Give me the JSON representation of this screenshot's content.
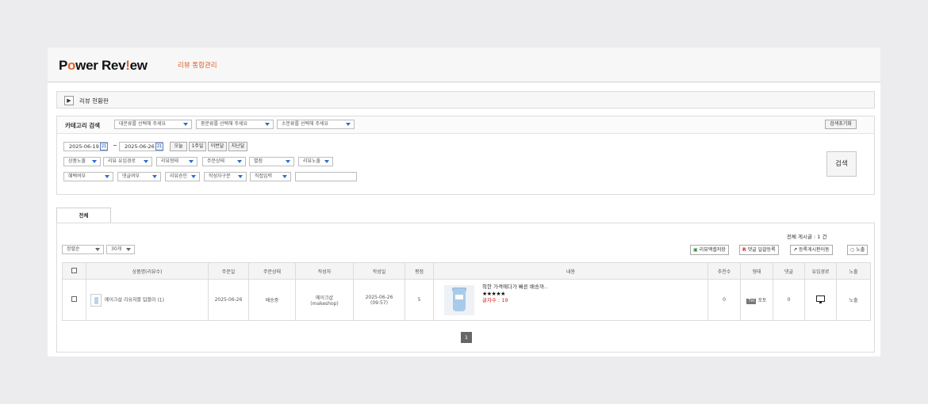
{
  "header": {
    "logo_parts": [
      "P",
      "o",
      "wer Rev",
      "!",
      "ew"
    ],
    "subtitle": "리뷰 통합관리"
  },
  "status_panel": {
    "label": "리뷰 현황판"
  },
  "category_search": {
    "title": "카테고리 검색",
    "large_placeholder": "대분류를 선택해 주세요",
    "medium_placeholder": "중분류를 선택해 주세요",
    "small_placeholder": "소분류를 선택해 주세요",
    "reset_label": "검색초기화"
  },
  "filters": {
    "date_from": "2025-06-19",
    "date_to": "2025-06-26",
    "tilde": "~",
    "calendar_glyph": "21",
    "quick_ranges": [
      "오늘",
      "1주일",
      "이번달",
      "지난달"
    ],
    "row1": [
      "상품노출",
      "리뷰 유입경로",
      "리뷰형태",
      "주문상태",
      "별점",
      "리뷰노출"
    ],
    "row2": [
      "혜택여부",
      "댓글여부",
      "리뷰승인",
      "작성자구분",
      "직접입력"
    ],
    "search_button": "검색"
  },
  "tabs": [
    {
      "label": "전체",
      "active": true
    }
  ],
  "list": {
    "sort_value": "정렬순",
    "page_size_value": "30개",
    "total_text": "전체 게시글 : 1 건",
    "actions": {
      "excel": {
        "icon": "▣",
        "label": "리뷰엑셀저장"
      },
      "bulk_reply": {
        "icon": "R",
        "label": "댓글 일괄등록"
      },
      "move_board": {
        "icon": "↗",
        "label": "등록게시판이동"
      },
      "expose": {
        "icon": "○",
        "label": "노출"
      }
    },
    "columns": [
      "상품명(리뷰수)",
      "주문일",
      "주문상태",
      "작성자",
      "작성일",
      "평점",
      "내용",
      "추천수",
      "형태",
      "댓글",
      "유입경로",
      "노출"
    ],
    "rows": [
      {
        "product": "메이크샵 리유저블 텀블러 (1)",
        "order_date": "2025-06-26",
        "order_status": "배송중",
        "writer_name": "메이크샵",
        "writer_id": "(makeshop)",
        "write_date": "2025-06-26",
        "write_time": "(09:57)",
        "rating": "5",
        "content_text": "착한 가격에다가 빠른 배송까..",
        "stars": "★★★★★",
        "char_count": "글자수 : 19",
        "recommend": "0",
        "type_badge": "Txt",
        "type_label": "포토",
        "comments": "0",
        "source_icon": "monitor-icon",
        "expose": "노출"
      }
    ],
    "pagination": [
      "1"
    ]
  },
  "colors": {
    "accent": "#e2622a",
    "link": "#2a6fc9",
    "warning": "#d42424"
  }
}
